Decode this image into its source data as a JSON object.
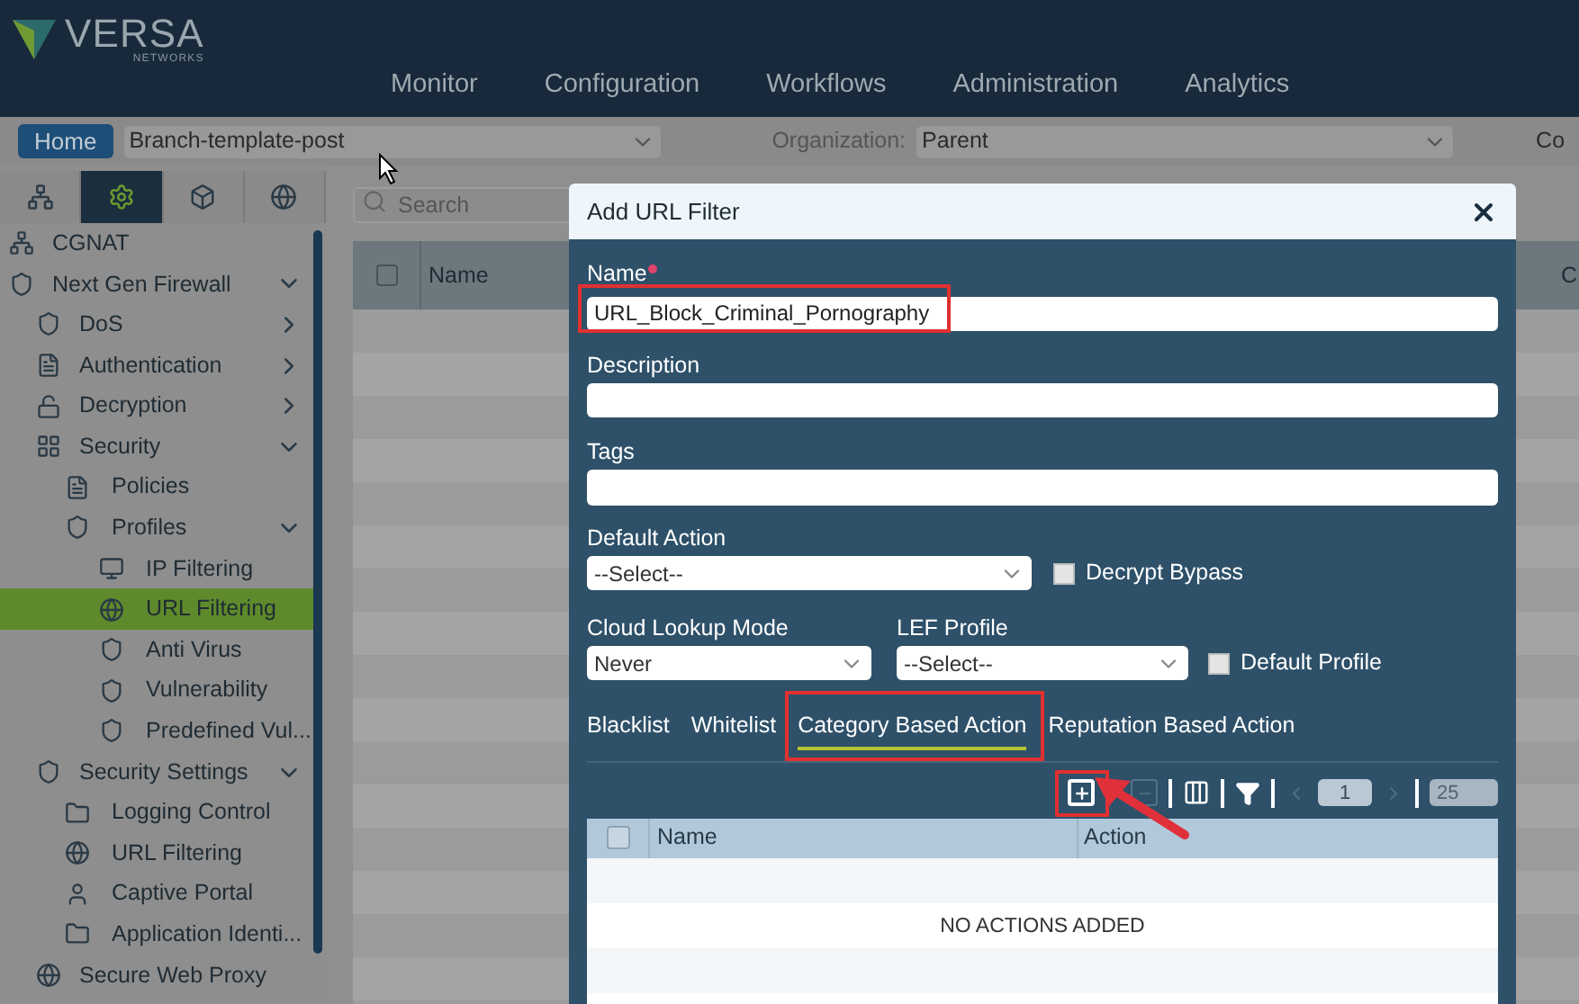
{
  "header": {
    "logo_text": "VERSA",
    "logo_subtext": "NETWORKS",
    "nav": [
      "Monitor",
      "Configuration",
      "Workflows",
      "Administration",
      "Analytics"
    ]
  },
  "context_bar": {
    "home": "Home",
    "template": "Branch-template-post",
    "organization_label": "Organization:",
    "organization": "Parent",
    "column_3": "Co"
  },
  "sidebar": {
    "icon_tabs": [
      {
        "selected": false
      },
      {
        "selected": true
      },
      {
        "selected": false
      },
      {
        "selected": false
      }
    ],
    "items": [
      {
        "label": "CGNAT",
        "selected": false
      },
      {
        "label": "Next Gen Firewall",
        "selected": false,
        "expanded": true,
        "children": [
          {
            "label": "DoS",
            "selected": false,
            "expanded": false
          },
          {
            "label": "Authentication",
            "selected": false,
            "expanded": false
          },
          {
            "label": "Decryption",
            "selected": false,
            "expanded": false
          },
          {
            "label": "Security",
            "selected": false,
            "expanded": true,
            "children": [
              {
                "label": "Policies",
                "selected": false
              },
              {
                "label": "Profiles",
                "selected": false,
                "expanded": true,
                "children": [
                  {
                    "label": "IP Filtering",
                    "selected": false
                  },
                  {
                    "label": "URL Filtering",
                    "selected": true
                  },
                  {
                    "label": "Anti Virus",
                    "selected": false
                  },
                  {
                    "label": "Vulnerability",
                    "selected": false
                  },
                  {
                    "label": "Predefined Vul...",
                    "selected": false
                  }
                ]
              }
            ]
          },
          {
            "label": "Security Settings",
            "selected": false,
            "expanded": true,
            "children": [
              {
                "label": "Logging Control",
                "selected": false
              },
              {
                "label": "URL Filtering",
                "selected": false
              },
              {
                "label": "Captive Portal",
                "selected": false
              },
              {
                "label": "Application Identi...",
                "selected": false
              }
            ]
          },
          {
            "label": "Secure Web Proxy",
            "selected": false
          }
        ]
      }
    ]
  },
  "list": {
    "search_placeholder": "Search",
    "select_all": {
      "checked": false
    },
    "columns": [
      "Name"
    ],
    "column_2": "C"
  },
  "dialog": {
    "title": "Add URL Filter",
    "name": {
      "label": "Name",
      "required": true,
      "value": "URL_Block_Criminal_Pornography"
    },
    "description": {
      "label": "Description"
    },
    "tags": {
      "label": "Tags"
    },
    "default_action": {
      "label": "Default Action",
      "value": "--Select--"
    },
    "decrypt_bypass": {
      "label": "Decrypt Bypass",
      "checked": false
    },
    "cloud_lookup_mode": {
      "label": "Cloud Lookup Mode",
      "value": "Never"
    },
    "lef_profile": {
      "label": "LEF Profile",
      "value": "--Select--"
    },
    "default_profile": {
      "label": "Default Profile",
      "checked": false
    },
    "tabs": [
      {
        "label": "Blacklist",
        "selected": false
      },
      {
        "label": "Whitelist",
        "selected": false
      },
      {
        "label": "Category Based Action",
        "selected": true
      },
      {
        "label": "Reputation Based Action",
        "selected": false
      }
    ],
    "toolbar": {
      "page": "1",
      "page_size": "25"
    },
    "table": {
      "select_all": {
        "checked": false
      },
      "columns": [
        "Name",
        "Action"
      ],
      "empty_text": "NO ACTIONS ADDED"
    }
  }
}
